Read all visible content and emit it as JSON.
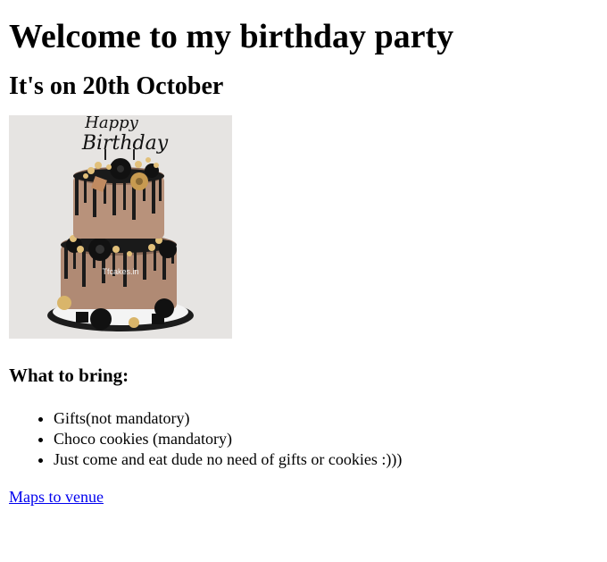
{
  "heading": "Welcome to my birthday party",
  "date_heading": "It's on 20th October",
  "image": {
    "topper_text_line1": "Happy",
    "topper_text_line2": "Birthday",
    "watermark": "Tfcakes.in"
  },
  "bring_heading": "What to bring:",
  "bring_items": [
    "Gifts(not mandatory)",
    "Choco cookies (mandatory)",
    "Just come and eat dude no need of gifts or cookies :)))"
  ],
  "maps_link": "Maps to venue",
  "colors": {
    "link": "#0000ee",
    "text": "#000000"
  }
}
